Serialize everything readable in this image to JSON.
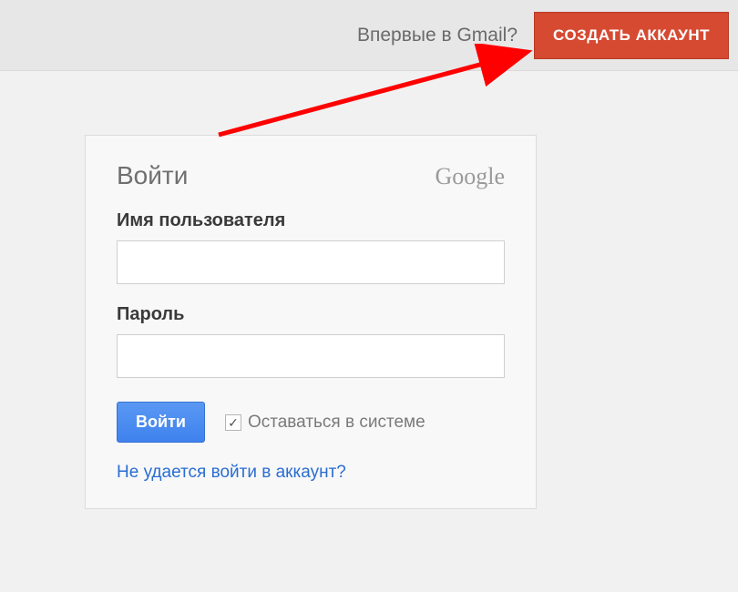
{
  "topbar": {
    "prompt": "Впервые в Gmail?",
    "create_button": "СОЗДАТЬ АККАУНТ"
  },
  "login": {
    "title": "Войти",
    "brand": "Google",
    "username_label": "Имя пользователя",
    "username_value": "",
    "password_label": "Пароль",
    "password_value": "",
    "signin_button": "Войти",
    "stay_signed_in": "Оставаться в системе",
    "stay_signed_in_checked": true,
    "help_link": "Не удается войти в аккаунт?"
  }
}
